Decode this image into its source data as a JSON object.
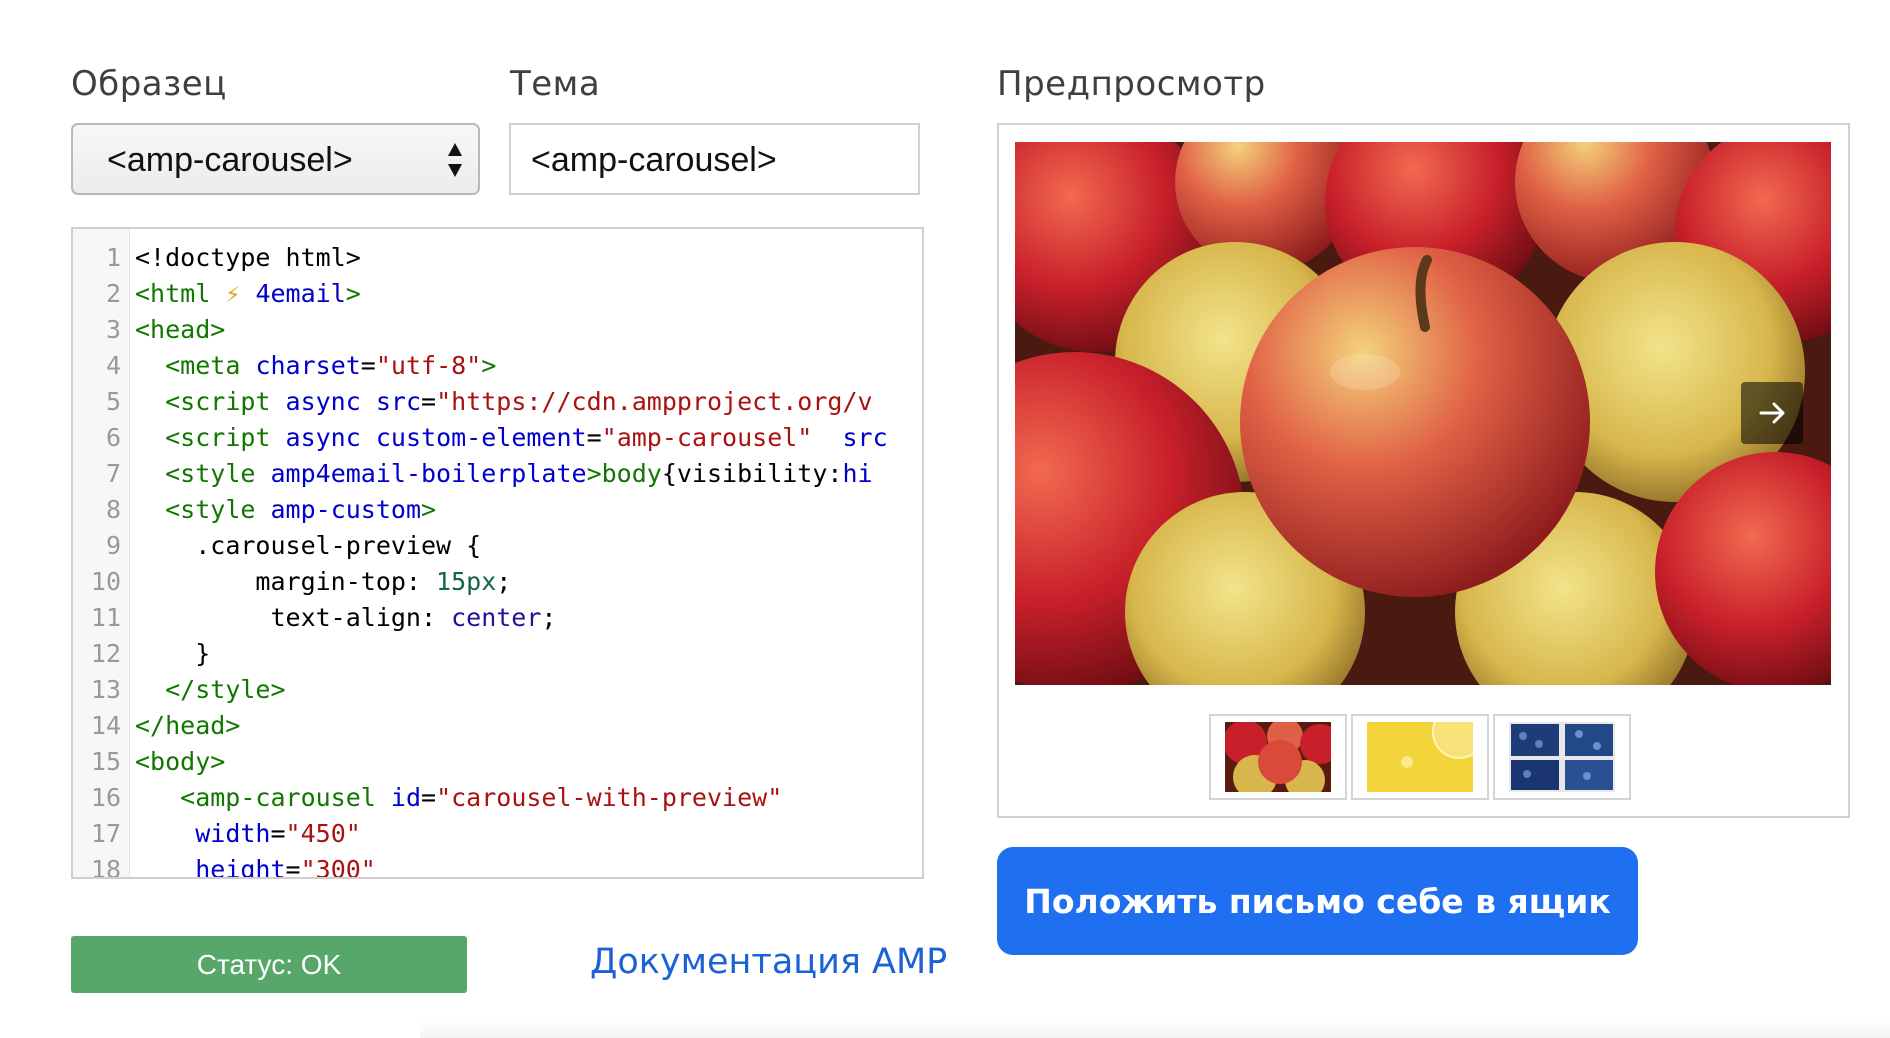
{
  "labels": {
    "sample": "Образец",
    "subject": "Тема",
    "preview": "Предпросмотр"
  },
  "sample_select": {
    "value": "<amp-carousel>"
  },
  "subject_input": {
    "value": "<amp-carousel>"
  },
  "status": {
    "text": "Статус: OK",
    "color": "#57a66a"
  },
  "doc_link": {
    "text": "Документация AMP",
    "color": "#1a62d6"
  },
  "send_button": {
    "text": "Положить письмо себе в ящик",
    "color": "#1f6ff1"
  },
  "code": {
    "line_numbers": [
      "1",
      "2",
      "3",
      "4",
      "5",
      "6",
      "7",
      "8",
      "9",
      "10",
      "11",
      "12",
      "13",
      "14",
      "15",
      "16",
      "17",
      "18"
    ],
    "l1": "<!doctype html>",
    "l2_tag": "<html",
    "l2_bolt": "⚡",
    "l2_attr": "4email",
    "l2_close": ">",
    "l3": "<head>",
    "l4_tag": "<meta",
    "l4_attr": "charset",
    "l4_eq": "=",
    "l4_str": "\"utf-8\"",
    "l4_close": ">",
    "l5_tag": "<script",
    "l5_attr1": "async",
    "l5_attr2": "src",
    "l5_eq": "=",
    "l5_str": "\"https://cdn.ampproject.org/v",
    "l6_tag": "<script",
    "l6_attr1": "async",
    "l6_attr2": "custom-element",
    "l6_eq": "=",
    "l6_str": "\"amp-carousel\"",
    "l6_attr3": "src",
    "l7_tag": "<style",
    "l7_attr": "amp4email-boilerplate",
    "l7_close": ">",
    "l7_tag2": "body",
    "l7_text": "{visibility:",
    "l7_kw": "hi",
    "l8_tag": "<style",
    "l8_attr": "amp-custom",
    "l8_close": ">",
    "l9": ".carousel-preview {",
    "l10_prop": "margin-top: ",
    "l10_num": "15px",
    "l10_end": ";",
    "l11_prop": "text-align: ",
    "l11_kw": "center",
    "l11_end": ";",
    "l12": "}",
    "l13": "</style>",
    "l14": "</head>",
    "l15": "<body>",
    "l16_tag": "<amp-carousel",
    "l16_attr": "id",
    "l16_eq": "=",
    "l16_str": "\"carousel-with-preview\"",
    "l17_attr": "width",
    "l17_eq": "=",
    "l17_str": "\"450\"",
    "l18_attr": "height",
    "l18_eq": "=",
    "l18_str": "\"300\""
  },
  "preview_panel": {
    "main_image": "apples-photo",
    "next_icon": "arrow-right-icon",
    "thumbnails": [
      "apples-thumbnail",
      "lemon-water-thumbnail",
      "blueberries-thumbnail"
    ]
  }
}
